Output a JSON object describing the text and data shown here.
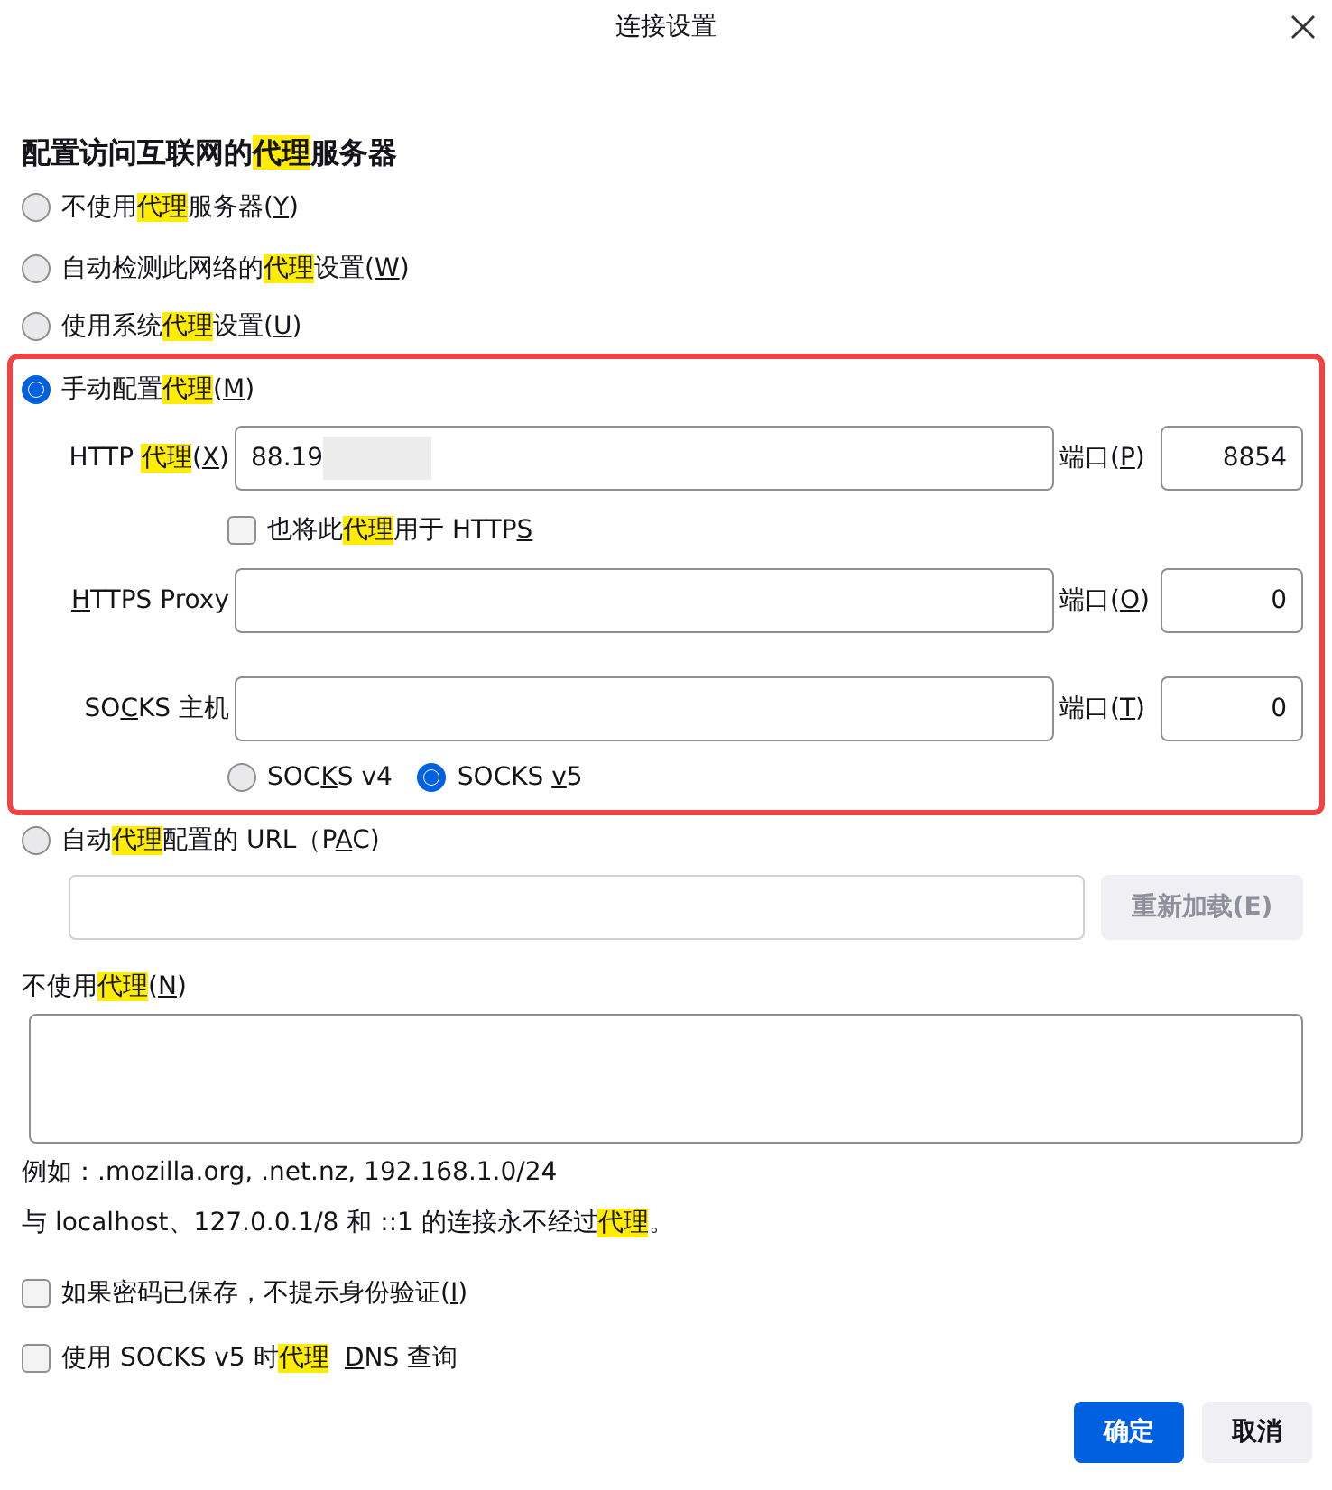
{
  "window": {
    "title": "连接设置"
  },
  "heading": [
    {
      "text": "配置访问互联网的",
      "kind": "plain"
    },
    {
      "text": "代理",
      "kind": "highlight"
    },
    {
      "text": "服务器",
      "kind": "plain"
    }
  ],
  "proxy_modes": [
    {
      "kind": "plain",
      "selected": false,
      "label": [
        {
          "text": "不使用",
          "kind": "plain"
        },
        {
          "text": "代理",
          "kind": "highlight"
        },
        {
          "text": "服务器(",
          "kind": "plain"
        },
        {
          "text": "Y",
          "kind": "accesskey"
        },
        {
          "text": ")",
          "kind": "plain"
        }
      ]
    },
    {
      "kind": "plain",
      "selected": false,
      "label": [
        {
          "text": "自动检测此网络的",
          "kind": "plain"
        },
        {
          "text": "代理",
          "kind": "highlight"
        },
        {
          "text": "设置(",
          "kind": "plain"
        },
        {
          "text": "W",
          "kind": "accesskey"
        },
        {
          "text": ")",
          "kind": "plain"
        }
      ]
    },
    {
      "kind": "plain",
      "selected": false,
      "label": [
        {
          "text": "使用系统",
          "kind": "plain"
        },
        {
          "text": "代理",
          "kind": "highlight"
        },
        {
          "text": "设置(",
          "kind": "plain"
        },
        {
          "text": "U",
          "kind": "accesskey"
        },
        {
          "text": ")",
          "kind": "plain"
        }
      ]
    },
    {
      "kind": "manual",
      "selected": true,
      "framed": true,
      "label": [
        {
          "text": "手动配置",
          "kind": "plain"
        },
        {
          "text": "代理",
          "kind": "highlight"
        },
        {
          "text": "(",
          "kind": "plain"
        },
        {
          "text": "M",
          "kind": "accesskey"
        },
        {
          "text": ")",
          "kind": "plain"
        }
      ],
      "http": {
        "label": [
          {
            "text": "HTTP ",
            "kind": "plain"
          },
          {
            "text": "代理",
            "kind": "highlight"
          },
          {
            "text": "(",
            "kind": "plain"
          },
          {
            "text": "X",
            "kind": "accesskey"
          },
          {
            "text": ")",
            "kind": "plain"
          }
        ],
        "value": "88.19",
        "redacted": true,
        "port_label": [
          {
            "text": "端口(",
            "kind": "plain"
          },
          {
            "text": "P",
            "kind": "accesskey"
          },
          {
            "text": ")",
            "kind": "plain"
          }
        ],
        "port": "8854"
      },
      "also_https": {
        "checked": false,
        "label": [
          {
            "text": "也将此",
            "kind": "plain"
          },
          {
            "text": "代理",
            "kind": "highlight"
          },
          {
            "text": "用于 HTTP",
            "kind": "plain"
          },
          {
            "text": "S",
            "kind": "accesskey"
          }
        ]
      },
      "https": {
        "label": [
          {
            "text": "H",
            "kind": "accesskey"
          },
          {
            "text": "TTPS Proxy",
            "kind": "plain"
          }
        ],
        "port_label": [
          {
            "text": "端口(",
            "kind": "plain"
          },
          {
            "text": "O",
            "kind": "accesskey"
          },
          {
            "text": ")",
            "kind": "plain"
          }
        ],
        "port": "0"
      },
      "socks": {
        "label": [
          {
            "text": "SO",
            "kind": "plain"
          },
          {
            "text": "C",
            "kind": "accesskey"
          },
          {
            "text": "KS 主机",
            "kind": "plain"
          }
        ],
        "port_label": [
          {
            "text": "端口(",
            "kind": "plain"
          },
          {
            "text": "T",
            "kind": "accesskey"
          },
          {
            "text": ")",
            "kind": "plain"
          }
        ],
        "port": "0"
      },
      "socks_versions": [
        {
          "selected": false,
          "label": [
            {
              "text": "SOC",
              "kind": "plain"
            },
            {
              "text": "K",
              "kind": "accesskey"
            },
            {
              "text": "S v4",
              "kind": "plain"
            }
          ]
        },
        {
          "selected": true,
          "label": [
            {
              "text": "SOCKS ",
              "kind": "plain"
            },
            {
              "text": "v",
              "kind": "accesskey"
            },
            {
              "text": "5",
              "kind": "plain"
            }
          ]
        }
      ]
    },
    {
      "kind": "pac",
      "selected": false,
      "label": [
        {
          "text": "自动",
          "kind": "plain"
        },
        {
          "text": "代理",
          "kind": "highlight"
        },
        {
          "text": "配置的 URL（P",
          "kind": "plain"
        },
        {
          "text": "A",
          "kind": "accesskey"
        },
        {
          "text": "C)",
          "kind": "plain"
        }
      ],
      "reload": {
        "label": "重新加载(E)",
        "disabled": true
      }
    }
  ],
  "no_proxy": {
    "label": [
      {
        "text": "不使用",
        "kind": "plain"
      },
      {
        "text": "代理",
        "kind": "highlight"
      },
      {
        "text": "(",
        "kind": "plain"
      },
      {
        "text": "N",
        "kind": "accesskey"
      },
      {
        "text": ")",
        "kind": "plain"
      }
    ]
  },
  "example": "例如：.mozilla.org, .net.nz, 192.168.1.0/24",
  "localhost_note": [
    {
      "text": "与 localhost、127.0.0.1/8 和 ::1 的连接永不经过",
      "kind": "plain"
    },
    {
      "text": "代理",
      "kind": "highlight"
    },
    {
      "text": "。",
      "kind": "plain"
    }
  ],
  "options": [
    {
      "checked": false,
      "label": [
        {
          "text": "如果密码已保存，不提示身份验证(",
          "kind": "plain"
        },
        {
          "text": "I",
          "kind": "accesskey"
        },
        {
          "text": ")",
          "kind": "plain"
        }
      ]
    },
    {
      "checked": false,
      "label": [
        {
          "text": "使用 SOCKS v5 时",
          "kind": "plain"
        },
        {
          "text": "代理",
          "kind": "highlight"
        },
        {
          "text": "D",
          "kind": "accesskey",
          "space_before": true
        },
        {
          "text": "NS 查询",
          "kind": "plain"
        }
      ]
    }
  ],
  "buttons": [
    {
      "label": "确定",
      "kind": "primary"
    },
    {
      "label": "取消",
      "kind": "secondary"
    }
  ]
}
